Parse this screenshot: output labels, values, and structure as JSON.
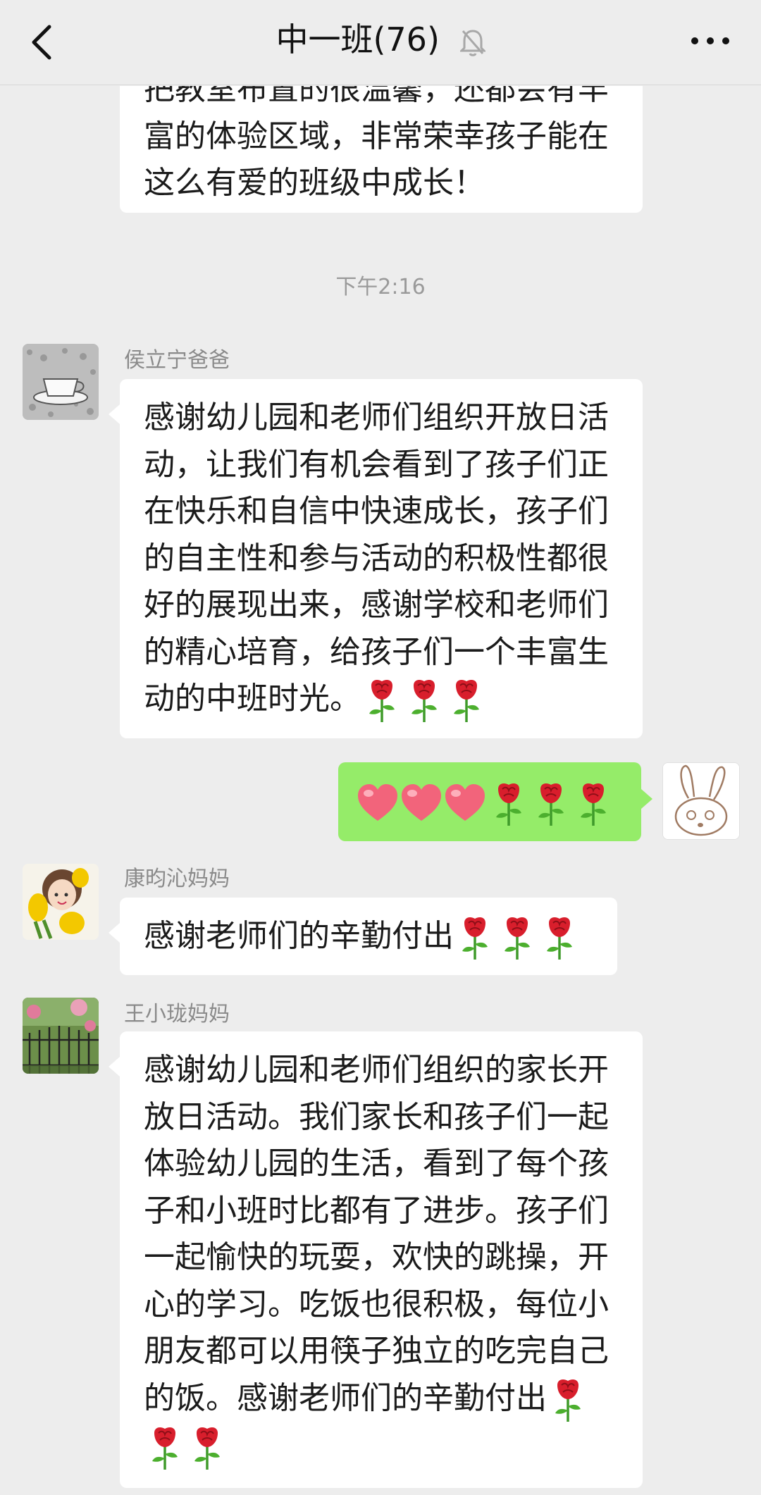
{
  "header": {
    "title": "中一班(76)",
    "back_icon": "chevron-left-icon",
    "mute_icon": "bell-muted-icon",
    "more_icon": "more-dots-icon"
  },
  "messages": [
    {
      "text_lines": [
        "把教室布置的很温馨，还都会有丰",
        "富的体验区域，非常荣幸孩子能在",
        "这么有爱的班级中成长！"
      ]
    },
    {
      "sender": "侯立宁爸爸",
      "text_lines": [
        "感谢幼儿园和老师们组织开放日活",
        "动，让我们有机会看到了孩子们正",
        "在快乐和自信中快速成长，孩子们",
        "的自主性和参与活动的积极性都很",
        "好的展现出来，感谢学校和老师们",
        "的精心培育，给孩子们一个丰富生",
        "动的中班时光。"
      ],
      "emoji_trailing": [
        "rose",
        "rose",
        "rose"
      ]
    },
    {
      "self": true,
      "emojis": [
        "heart",
        "heart",
        "heart",
        "rose",
        "rose",
        "rose"
      ]
    },
    {
      "sender": "康昀沁妈妈",
      "text": "感谢老师们的辛勤付出",
      "emoji_trailing": [
        "rose",
        "rose",
        "rose"
      ]
    },
    {
      "sender": "王小珑妈妈",
      "text_lines": [
        "感谢幼儿园和老师们组织的家长开",
        "放日活动。我们家长和孩子们一起",
        "体验幼儿园的生活，看到了每个孩",
        "子和小班时比都有了进步。孩子们",
        "一起愉快的玩耍，欢快的跳操，开",
        "心的学习。吃饭也很积极，每位小",
        "朋友都可以用筷子独立的吃完自己",
        "的饭。感谢老师们的辛勤付出"
      ],
      "emoji_trailing": [
        "rose",
        "rose",
        "rose"
      ]
    }
  ],
  "timestamp": "下午2:16",
  "colors": {
    "background": "#ededed",
    "bubble_self": "#95ec69",
    "bubble_other": "#ffffff"
  }
}
